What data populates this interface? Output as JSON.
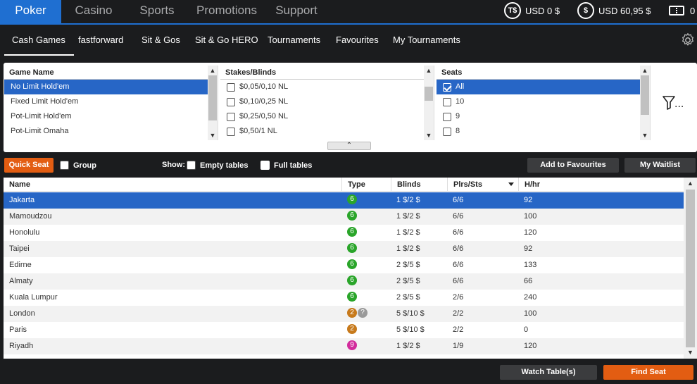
{
  "topnav": {
    "tabs": [
      {
        "label": "Poker",
        "active": true
      },
      {
        "label": "Casino",
        "active": false
      },
      {
        "label": "Sports",
        "active": false
      },
      {
        "label": "Promotions",
        "active": false
      },
      {
        "label": "Support",
        "active": false
      }
    ],
    "wallets": [
      {
        "icon": "t-dollar-coin-icon",
        "icon_text": "T$",
        "amount": "USD 0 $"
      },
      {
        "icon": "dollar-coin-icon",
        "icon_text": "$",
        "amount": "USD 60,95 $"
      },
      {
        "icon": "ticket-icon",
        "amount": "0"
      }
    ]
  },
  "subnav": {
    "tabs": [
      "Cash Games",
      "fastforward",
      "Sit & Gos",
      "Sit & Go HERO",
      "Tournaments",
      "Favourites",
      "My Tournaments"
    ],
    "active": "Cash Games"
  },
  "filters": {
    "game_name": {
      "header": "Game Name",
      "items": [
        "No Limit Hold'em",
        "Fixed Limit Hold'em",
        "Pot-Limit Hold'em",
        "Pot-Limit Omaha"
      ],
      "selected": "No Limit Hold'em"
    },
    "stakes": {
      "header": "Stakes/Blinds",
      "items": [
        "$0,05/0,10 NL",
        "$0,10/0,25 NL",
        "$0,25/0,50 NL",
        "$0,50/1 NL"
      ]
    },
    "seats": {
      "header": "Seats",
      "items": [
        "All",
        "10",
        "9",
        "8"
      ],
      "checked": "All"
    },
    "more_icon_text": "..."
  },
  "actions": {
    "quick_seat": "Quick Seat",
    "group": "Group",
    "show": "Show:",
    "empty_tables": "Empty tables",
    "full_tables": "Full tables",
    "empty_tables_checked": false,
    "full_tables_checked": true,
    "add_favourites": "Add to Favourites",
    "my_waitlist": "My Waitlist"
  },
  "table": {
    "columns": [
      "Name",
      "Type",
      "Blinds",
      "Plrs/Sts",
      "H/hr"
    ],
    "sorted_by": "Plrs/Sts",
    "rows": [
      {
        "name": "Jakarta",
        "type": "6",
        "type_color": "#2aa52a",
        "blinds": "1 $/2 $",
        "plrs": "6/6",
        "hhr": "92"
      },
      {
        "name": "Mamoudzou",
        "type": "6",
        "type_color": "#2aa52a",
        "blinds": "1 $/2 $",
        "plrs": "6/6",
        "hhr": "100"
      },
      {
        "name": "Honolulu",
        "type": "6",
        "type_color": "#2aa52a",
        "blinds": "1 $/2 $",
        "plrs": "6/6",
        "hhr": "120"
      },
      {
        "name": "Taipei",
        "type": "6",
        "type_color": "#2aa52a",
        "blinds": "1 $/2 $",
        "plrs": "6/6",
        "hhr": "92"
      },
      {
        "name": "Edirne",
        "type": "6",
        "type_color": "#2aa52a",
        "blinds": "2 $/5 $",
        "plrs": "6/6",
        "hhr": "133"
      },
      {
        "name": "Almaty",
        "type": "6",
        "type_color": "#2aa52a",
        "blinds": "2 $/5 $",
        "plrs": "6/6",
        "hhr": "66"
      },
      {
        "name": "Kuala Lumpur",
        "type": "6",
        "type_color": "#2aa52a",
        "blinds": "2 $/5 $",
        "plrs": "2/6",
        "hhr": "240"
      },
      {
        "name": "London",
        "type": "2",
        "type_color": "#c77a1c",
        "extra_badge": "?",
        "blinds": "5 $/10 $",
        "plrs": "2/2",
        "hhr": "100"
      },
      {
        "name": "Paris",
        "type": "2",
        "type_color": "#c77a1c",
        "blinds": "5 $/10 $",
        "plrs": "2/2",
        "hhr": "0"
      },
      {
        "name": "Riyadh",
        "type": "9",
        "type_color": "#d22c9c",
        "blinds": "1 $/2 $",
        "plrs": "1/9",
        "hhr": "120"
      }
    ]
  },
  "bottom": {
    "watch_tables": "Watch Table(s)",
    "find_seat": "Find Seat"
  },
  "colors": {
    "accent_blue": "#1f6fd1",
    "selection_blue": "#2766c6",
    "orange": "#e35d12",
    "background": "#1b1c1e"
  }
}
